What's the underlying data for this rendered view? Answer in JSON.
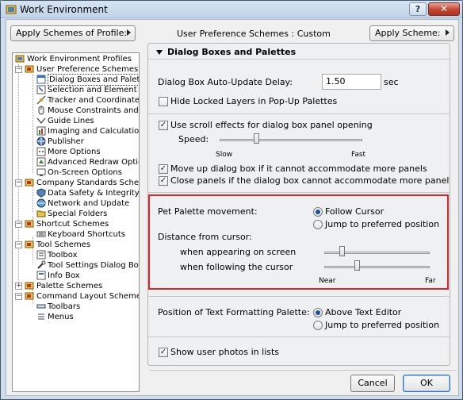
{
  "window": {
    "title": "Work Environment",
    "help_label": "?",
    "close_label": "✕"
  },
  "toolbar": {
    "apply_profile_label": "Apply Schemes of Profile:",
    "schemes_label": "User Preference Schemes : Custom",
    "apply_scheme_label": "Apply Scheme:"
  },
  "tree": {
    "root": "Work Environment Profiles",
    "groups": [
      {
        "label": "User Preference Schemes",
        "children": [
          "Dialog Boxes and Palettes",
          "Selection and Element Inform",
          "Tracker and Coordinate Inpu",
          "Mouse Constraints and Meth",
          "Guide Lines",
          "Imaging and Calculation",
          "Publisher",
          "More Options",
          "Advanced Redraw Options",
          "On-Screen Options"
        ]
      },
      {
        "label": "Company Standards Schemes",
        "children": [
          "Data Safety & Integrity",
          "Network and Update",
          "Special Folders"
        ]
      },
      {
        "label": "Shortcut Schemes",
        "children": [
          "Keyboard Shortcuts"
        ]
      },
      {
        "label": "Tool Schemes",
        "children": [
          "Toolbox",
          "Tool Settings Dialog Boxes",
          "Info Box"
        ]
      },
      {
        "label": "Palette Schemes",
        "children": []
      },
      {
        "label": "Command Layout Schemes",
        "children": [
          "Toolbars",
          "Menus"
        ]
      }
    ]
  },
  "panel": {
    "section_title": "Dialog Boxes and Palettes",
    "autoupdate_label": "Dialog Box Auto-Update Delay:",
    "autoupdate_value": "1.50",
    "autoupdate_unit": "sec",
    "hide_locked_label": "Hide Locked Layers in Pop-Up Palettes",
    "hide_locked_checked": false,
    "scroll_effects_label": "Use scroll effects for dialog box panel opening",
    "scroll_effects_checked": true,
    "speed_label": "Speed:",
    "speed_slow": "Slow",
    "speed_fast": "Fast",
    "speed_value": 0.25,
    "move_up_label": "Move up dialog box if it cannot accommodate more panels",
    "move_up_checked": true,
    "close_panels_label": "Close panels if the dialog box cannot accommodate more panels",
    "close_panels_checked": true,
    "pet_palette_label": "Pet Palette movement:",
    "follow_cursor_label": "Follow Cursor",
    "jump_pref_label": "Jump to preferred position",
    "pet_palette_selected": "Follow Cursor",
    "distance_label": "Distance from cursor:",
    "appearing_label": "when appearing on screen",
    "appearing_value": 0.15,
    "following_label": "when following the cursor",
    "following_value": 0.3,
    "near_label": "Near",
    "far_label": "Far",
    "text_palette_label": "Position of Text Formatting Palette:",
    "above_editor_label": "Above Text Editor",
    "jump_pref2_label": "Jump to preferred position",
    "text_palette_selected": "Above Text Editor",
    "show_photos_label": "Show user photos in lists",
    "show_photos_checked": true
  },
  "footer": {
    "cancel_label": "Cancel",
    "ok_label": "OK"
  },
  "colors": {
    "highlight": "#e0222a",
    "accent": "#1d4fa0"
  }
}
